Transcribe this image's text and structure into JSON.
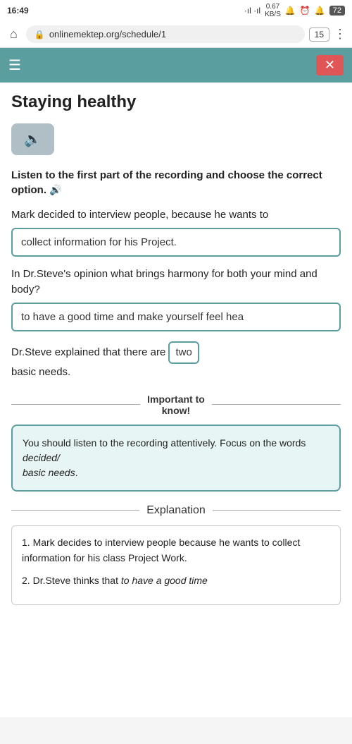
{
  "statusBar": {
    "time": "16:49",
    "signal": "·ıl ·ıl",
    "network": "0.67\nKB/S",
    "batteryValue": "72"
  },
  "browserBar": {
    "url": "onlinemektep.org/schedule/1",
    "tabCount": "15"
  },
  "actionBar": {
    "hamburgerIcon": "☰",
    "closeIcon": "✕"
  },
  "pageTitle": "Staying healthy",
  "audioButtonIcon": "🔊",
  "instruction": "Listen to the first part of the recording and choose the correct option.",
  "audioIcon": "🔊",
  "question1": {
    "text": "Mark decided to interview people, because he wants to",
    "answer": "collect information for his Project."
  },
  "question2": {
    "text": "In Dr.Steve's opinion what brings harmony for both your mind and body?",
    "answer": "to have a good time and make yourself feel hea"
  },
  "question3": {
    "prefix": "Dr.Steve explained that there are",
    "answer": "two",
    "suffix": "basic needs."
  },
  "importantSection": {
    "leftLine": true,
    "label": "Important to\nknow!",
    "rightLine": true
  },
  "infoBox": {
    "text1": "You should listen to the recording attentively. Focus on the words ",
    "italic1": "decided/",
    "text2": "\n",
    "italic2": "basic needs",
    "text3": "."
  },
  "explanationLabel": "Explanation",
  "explanationItems": [
    {
      "number": "1.",
      "text": "Mark decides to interview people because he wants to collect information for his class Project Work."
    },
    {
      "number": "2.",
      "text": "Dr.Steve thinks that ",
      "italic": "to have a good time"
    }
  ]
}
